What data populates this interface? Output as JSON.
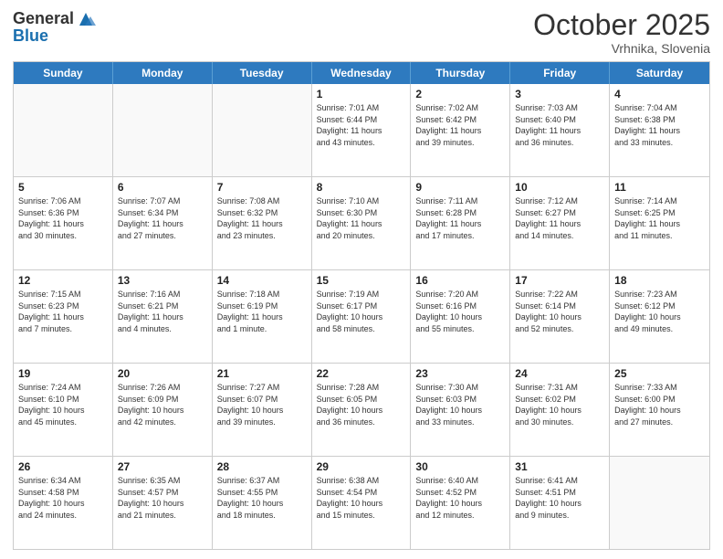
{
  "header": {
    "logo_general": "General",
    "logo_blue": "Blue",
    "month_title": "October 2025",
    "subtitle": "Vrhnika, Slovenia"
  },
  "days_of_week": [
    "Sunday",
    "Monday",
    "Tuesday",
    "Wednesday",
    "Thursday",
    "Friday",
    "Saturday"
  ],
  "weeks": [
    [
      {
        "day": "",
        "info": ""
      },
      {
        "day": "",
        "info": ""
      },
      {
        "day": "",
        "info": ""
      },
      {
        "day": "1",
        "info": "Sunrise: 7:01 AM\nSunset: 6:44 PM\nDaylight: 11 hours\nand 43 minutes."
      },
      {
        "day": "2",
        "info": "Sunrise: 7:02 AM\nSunset: 6:42 PM\nDaylight: 11 hours\nand 39 minutes."
      },
      {
        "day": "3",
        "info": "Sunrise: 7:03 AM\nSunset: 6:40 PM\nDaylight: 11 hours\nand 36 minutes."
      },
      {
        "day": "4",
        "info": "Sunrise: 7:04 AM\nSunset: 6:38 PM\nDaylight: 11 hours\nand 33 minutes."
      }
    ],
    [
      {
        "day": "5",
        "info": "Sunrise: 7:06 AM\nSunset: 6:36 PM\nDaylight: 11 hours\nand 30 minutes."
      },
      {
        "day": "6",
        "info": "Sunrise: 7:07 AM\nSunset: 6:34 PM\nDaylight: 11 hours\nand 27 minutes."
      },
      {
        "day": "7",
        "info": "Sunrise: 7:08 AM\nSunset: 6:32 PM\nDaylight: 11 hours\nand 23 minutes."
      },
      {
        "day": "8",
        "info": "Sunrise: 7:10 AM\nSunset: 6:30 PM\nDaylight: 11 hours\nand 20 minutes."
      },
      {
        "day": "9",
        "info": "Sunrise: 7:11 AM\nSunset: 6:28 PM\nDaylight: 11 hours\nand 17 minutes."
      },
      {
        "day": "10",
        "info": "Sunrise: 7:12 AM\nSunset: 6:27 PM\nDaylight: 11 hours\nand 14 minutes."
      },
      {
        "day": "11",
        "info": "Sunrise: 7:14 AM\nSunset: 6:25 PM\nDaylight: 11 hours\nand 11 minutes."
      }
    ],
    [
      {
        "day": "12",
        "info": "Sunrise: 7:15 AM\nSunset: 6:23 PM\nDaylight: 11 hours\nand 7 minutes."
      },
      {
        "day": "13",
        "info": "Sunrise: 7:16 AM\nSunset: 6:21 PM\nDaylight: 11 hours\nand 4 minutes."
      },
      {
        "day": "14",
        "info": "Sunrise: 7:18 AM\nSunset: 6:19 PM\nDaylight: 11 hours\nand 1 minute."
      },
      {
        "day": "15",
        "info": "Sunrise: 7:19 AM\nSunset: 6:17 PM\nDaylight: 10 hours\nand 58 minutes."
      },
      {
        "day": "16",
        "info": "Sunrise: 7:20 AM\nSunset: 6:16 PM\nDaylight: 10 hours\nand 55 minutes."
      },
      {
        "day": "17",
        "info": "Sunrise: 7:22 AM\nSunset: 6:14 PM\nDaylight: 10 hours\nand 52 minutes."
      },
      {
        "day": "18",
        "info": "Sunrise: 7:23 AM\nSunset: 6:12 PM\nDaylight: 10 hours\nand 49 minutes."
      }
    ],
    [
      {
        "day": "19",
        "info": "Sunrise: 7:24 AM\nSunset: 6:10 PM\nDaylight: 10 hours\nand 45 minutes."
      },
      {
        "day": "20",
        "info": "Sunrise: 7:26 AM\nSunset: 6:09 PM\nDaylight: 10 hours\nand 42 minutes."
      },
      {
        "day": "21",
        "info": "Sunrise: 7:27 AM\nSunset: 6:07 PM\nDaylight: 10 hours\nand 39 minutes."
      },
      {
        "day": "22",
        "info": "Sunrise: 7:28 AM\nSunset: 6:05 PM\nDaylight: 10 hours\nand 36 minutes."
      },
      {
        "day": "23",
        "info": "Sunrise: 7:30 AM\nSunset: 6:03 PM\nDaylight: 10 hours\nand 33 minutes."
      },
      {
        "day": "24",
        "info": "Sunrise: 7:31 AM\nSunset: 6:02 PM\nDaylight: 10 hours\nand 30 minutes."
      },
      {
        "day": "25",
        "info": "Sunrise: 7:33 AM\nSunset: 6:00 PM\nDaylight: 10 hours\nand 27 minutes."
      }
    ],
    [
      {
        "day": "26",
        "info": "Sunrise: 6:34 AM\nSunset: 4:58 PM\nDaylight: 10 hours\nand 24 minutes."
      },
      {
        "day": "27",
        "info": "Sunrise: 6:35 AM\nSunset: 4:57 PM\nDaylight: 10 hours\nand 21 minutes."
      },
      {
        "day": "28",
        "info": "Sunrise: 6:37 AM\nSunset: 4:55 PM\nDaylight: 10 hours\nand 18 minutes."
      },
      {
        "day": "29",
        "info": "Sunrise: 6:38 AM\nSunset: 4:54 PM\nDaylight: 10 hours\nand 15 minutes."
      },
      {
        "day": "30",
        "info": "Sunrise: 6:40 AM\nSunset: 4:52 PM\nDaylight: 10 hours\nand 12 minutes."
      },
      {
        "day": "31",
        "info": "Sunrise: 6:41 AM\nSunset: 4:51 PM\nDaylight: 10 hours\nand 9 minutes."
      },
      {
        "day": "",
        "info": ""
      }
    ]
  ]
}
